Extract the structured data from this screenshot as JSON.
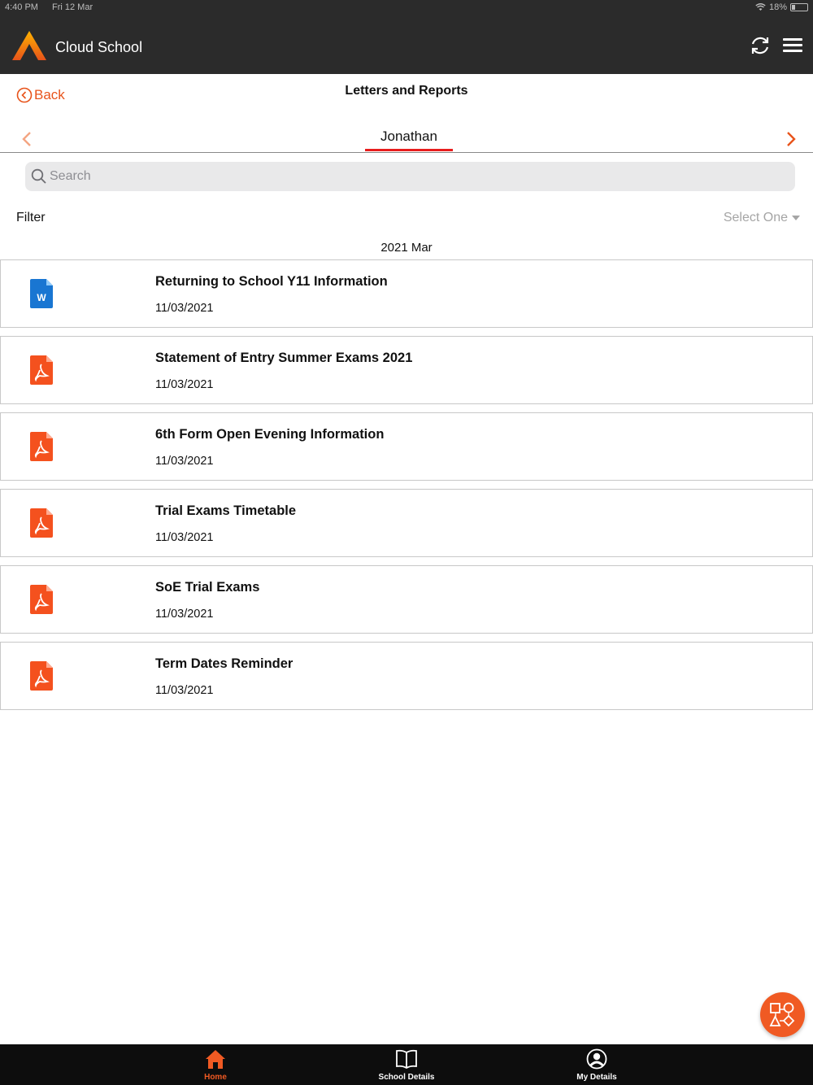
{
  "status_bar": {
    "time": "4:40 PM",
    "date": "Fri 12 Mar",
    "battery": "18%"
  },
  "header": {
    "app_title": "Cloud School"
  },
  "nav": {
    "back_label": "Back",
    "page_title": "Letters and Reports"
  },
  "student": {
    "name": "Jonathan"
  },
  "search": {
    "placeholder": "Search",
    "value": ""
  },
  "filter": {
    "label": "Filter",
    "selected": "Select One"
  },
  "section": {
    "header": "2021 Mar"
  },
  "documents": [
    {
      "title": "Returning to School Y11 Information",
      "date": "11/03/2021",
      "type": "word-doc-icon"
    },
    {
      "title": "Statement of Entry Summer Exams 2021",
      "date": "11/03/2021",
      "type": "pdf-icon"
    },
    {
      "title": "6th Form Open Evening Information",
      "date": "11/03/2021",
      "type": "pdf-icon"
    },
    {
      "title": "Trial Exams Timetable",
      "date": "11/03/2021",
      "type": "pdf-icon"
    },
    {
      "title": "SoE Trial Exams",
      "date": "11/03/2021",
      "type": "pdf-icon"
    },
    {
      "title": "Term Dates Reminder",
      "date": "11/03/2021",
      "type": "pdf-icon"
    }
  ],
  "tabs": [
    {
      "label": "Home",
      "icon": "home-icon",
      "active": true
    },
    {
      "label": "School Details",
      "icon": "book-icon",
      "active": false
    },
    {
      "label": "My Details",
      "icon": "user-circle-icon",
      "active": false
    }
  ],
  "colors": {
    "accent": "#f05a23",
    "header_bg": "#2b2b2b",
    "tab_bg": "#0d0d0d",
    "underline": "#e81d1d",
    "word_blue": "#1976d2"
  }
}
